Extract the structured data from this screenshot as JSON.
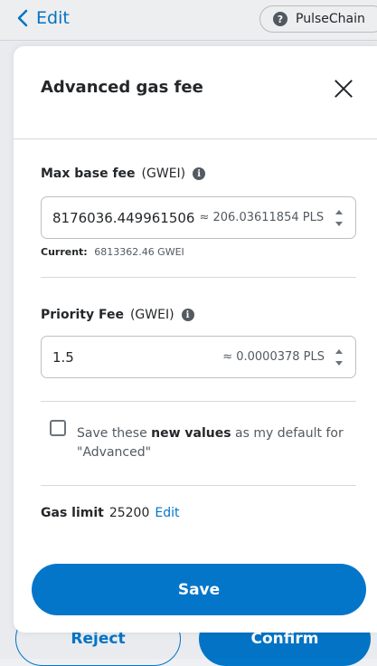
{
  "header": {
    "back_label": "Edit",
    "network_label": "PulseChain"
  },
  "footer": {
    "reject_label": "Reject",
    "confirm_label": "Confirm"
  },
  "modal": {
    "title": "Advanced gas fee",
    "max_base_fee": {
      "label": "Max base fee",
      "unit": "(GWEI)",
      "value": "8176036.449961506",
      "conversion": "≈ 206.03611854 PLS",
      "current_label": "Current:",
      "current_value": "6813362.46 GWEI"
    },
    "priority_fee": {
      "label": "Priority Fee",
      "unit": "(GWEI)",
      "value": "1.5",
      "conversion": "≈ 0.0000378 PLS"
    },
    "default_checkbox": {
      "text_before": "Save these ",
      "text_bold": "new values",
      "text_after": " as my default for \"Advanced\"",
      "checked": false
    },
    "gas_limit": {
      "label": "Gas limit",
      "value": "25200",
      "edit_label": "Edit"
    },
    "save_label": "Save"
  },
  "colors": {
    "accent": "#0376c9",
    "text": "#24272a",
    "muted": "#535a61",
    "border": "#bbc0c5"
  }
}
